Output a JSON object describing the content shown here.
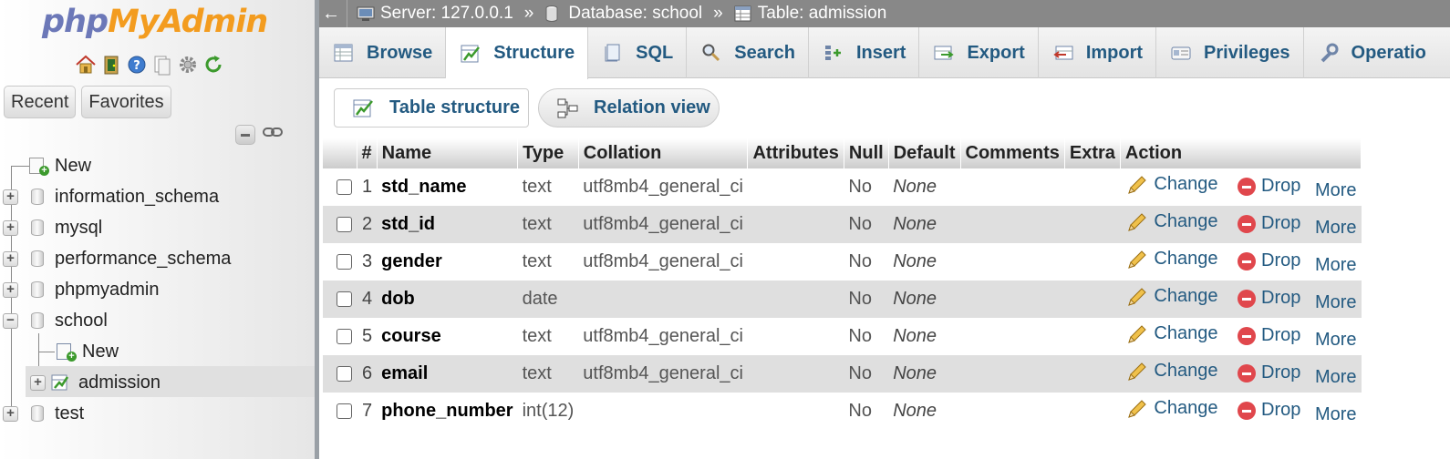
{
  "logo": {
    "part1": "php",
    "part2": "MyAdmin"
  },
  "nav_buttons": {
    "recent": "Recent",
    "favorites": "Favorites"
  },
  "tree": {
    "new": "New",
    "databases": [
      "information_schema",
      "mysql",
      "performance_schema",
      "phpmyadmin",
      "school",
      "test"
    ],
    "school_children": {
      "new": "New",
      "admission": "admission"
    }
  },
  "breadcrumb": {
    "back": "←",
    "server": "Server: 127.0.0.1",
    "database": "Database: school",
    "table": "Table: admission",
    "sep": "»"
  },
  "tabs": [
    "Browse",
    "Structure",
    "SQL",
    "Search",
    "Insert",
    "Export",
    "Import",
    "Privileges",
    "Operatio"
  ],
  "active_tab": "Structure",
  "subtabs": {
    "table_structure": "Table structure",
    "relation_view": "Relation view"
  },
  "columns": [
    "#",
    "Name",
    "Type",
    "Collation",
    "Attributes",
    "Null",
    "Default",
    "Comments",
    "Extra",
    "Action"
  ],
  "actions": {
    "change": "Change",
    "drop": "Drop",
    "more": "More"
  },
  "rows": [
    {
      "num": "1",
      "name": "std_name",
      "type": "text",
      "collation": "utf8mb4_general_ci",
      "attributes": "",
      "null": "No",
      "default": "None",
      "comments": "",
      "extra": ""
    },
    {
      "num": "2",
      "name": "std_id",
      "type": "text",
      "collation": "utf8mb4_general_ci",
      "attributes": "",
      "null": "No",
      "default": "None",
      "comments": "",
      "extra": ""
    },
    {
      "num": "3",
      "name": "gender",
      "type": "text",
      "collation": "utf8mb4_general_ci",
      "attributes": "",
      "null": "No",
      "default": "None",
      "comments": "",
      "extra": ""
    },
    {
      "num": "4",
      "name": "dob",
      "type": "date",
      "collation": "",
      "attributes": "",
      "null": "No",
      "default": "None",
      "comments": "",
      "extra": ""
    },
    {
      "num": "5",
      "name": "course",
      "type": "text",
      "collation": "utf8mb4_general_ci",
      "attributes": "",
      "null": "No",
      "default": "None",
      "comments": "",
      "extra": ""
    },
    {
      "num": "6",
      "name": "email",
      "type": "text",
      "collation": "utf8mb4_general_ci",
      "attributes": "",
      "null": "No",
      "default": "None",
      "comments": "",
      "extra": ""
    },
    {
      "num": "7",
      "name": "phone_number",
      "type": "int(12)",
      "collation": "",
      "attributes": "",
      "null": "No",
      "default": "None",
      "comments": "",
      "extra": ""
    }
  ],
  "colors": {
    "link": "#235a81",
    "drop": "#e0474c",
    "topbar": "#888888",
    "row_alt": "#dfdfdf"
  }
}
